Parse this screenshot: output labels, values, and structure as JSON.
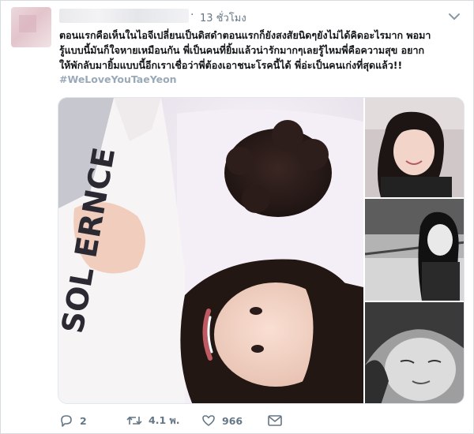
{
  "tweet": {
    "time": "13 ชั่วโมง",
    "text_lines": [
      "ตอนแรกคือเห็นในไอจีเปลี่ยนเป็นดิสดำตอนแรกก็ยังสงสัยนิดๆยังไม่ได้คิดอะไรมาก พอมา",
      "รู้แบบนี้มันก็ใจหายเหมือนกัน พี่เป็นคนที่ยิ้มแล้วน่ารักมากๆเลยรู้ไหมพี่คือความสุข อยาก",
      "ให้พักลับมายิ้มแบบนี้อีกเราเชื่อว่าพี่ต้องเอาชนะโรคนี้ได้ พี่อ่ะเป็นคนเก่งที่สุดแล้ว!!"
    ],
    "hashtag": "#WeLoveYouTaeYeon",
    "sweater_text": "SOL ERNCE"
  },
  "actions": {
    "reply_count": "2",
    "retweet_count": "4.1 พ.",
    "like_count": "966"
  },
  "colors": {
    "text": "#14171a",
    "muted": "#657786",
    "hashtag": "#9aa9b8",
    "border": "#e1e8ed"
  },
  "icons": [
    "chevron-down-icon",
    "reply-icon",
    "retweet-icon",
    "heart-icon",
    "envelope-icon"
  ]
}
